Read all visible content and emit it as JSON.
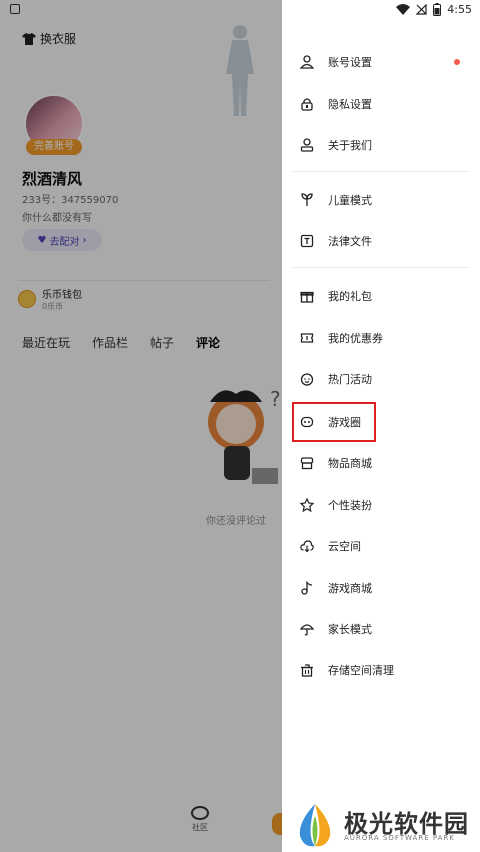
{
  "background": {
    "skin_label": "换衣服",
    "complete_badge": "完善账号",
    "username": "烈酒清风",
    "user_id": "233号：347559070",
    "bio": "你什么都没有写",
    "match_button": "去配对",
    "wallet_title": "乐币钱包",
    "wallet_value": "0乐币",
    "tabs": [
      "最近在玩",
      "作品栏",
      "帖子",
      "评论"
    ],
    "active_tab": "评论",
    "empty_text": "你还没评论过",
    "nav_label": "社区"
  },
  "status_bar": {
    "time": "4:55"
  },
  "drawer": {
    "items": [
      {
        "label": "账号设置",
        "icon": "person-icon",
        "dot": true
      },
      {
        "label": "隐私设置",
        "icon": "lock-icon"
      },
      {
        "label": "关于我们",
        "icon": "about-person-icon"
      },
      {
        "label": "儿童模式",
        "icon": "sprout-icon"
      },
      {
        "label": "法律文件",
        "icon": "document-t-icon"
      },
      {
        "label": "我的礼包",
        "icon": "gift-icon"
      },
      {
        "label": "我的优惠券",
        "icon": "ticket-icon"
      },
      {
        "label": "热门活动",
        "icon": "smile-icon"
      },
      {
        "label": "游戏圈",
        "icon": "game-circle-icon",
        "highlighted": true
      },
      {
        "label": "物品商城",
        "icon": "store-icon"
      },
      {
        "label": "个性装扮",
        "icon": "star-dress-icon"
      },
      {
        "label": "云空间",
        "icon": "cloud-download-icon"
      },
      {
        "label": "游戏商城",
        "icon": "music-note-icon"
      },
      {
        "label": "家长模式",
        "icon": "umbrella-icon"
      },
      {
        "label": "存储空间清理",
        "icon": "trash-icon"
      }
    ]
  },
  "watermark": {
    "title": "极光软件园",
    "subtitle": "AURORA SOFTWARE PARK"
  },
  "colors": {
    "accent_orange": "#f29b2c",
    "badge_red": "#f25b4b",
    "highlight_red": "#e02020"
  }
}
